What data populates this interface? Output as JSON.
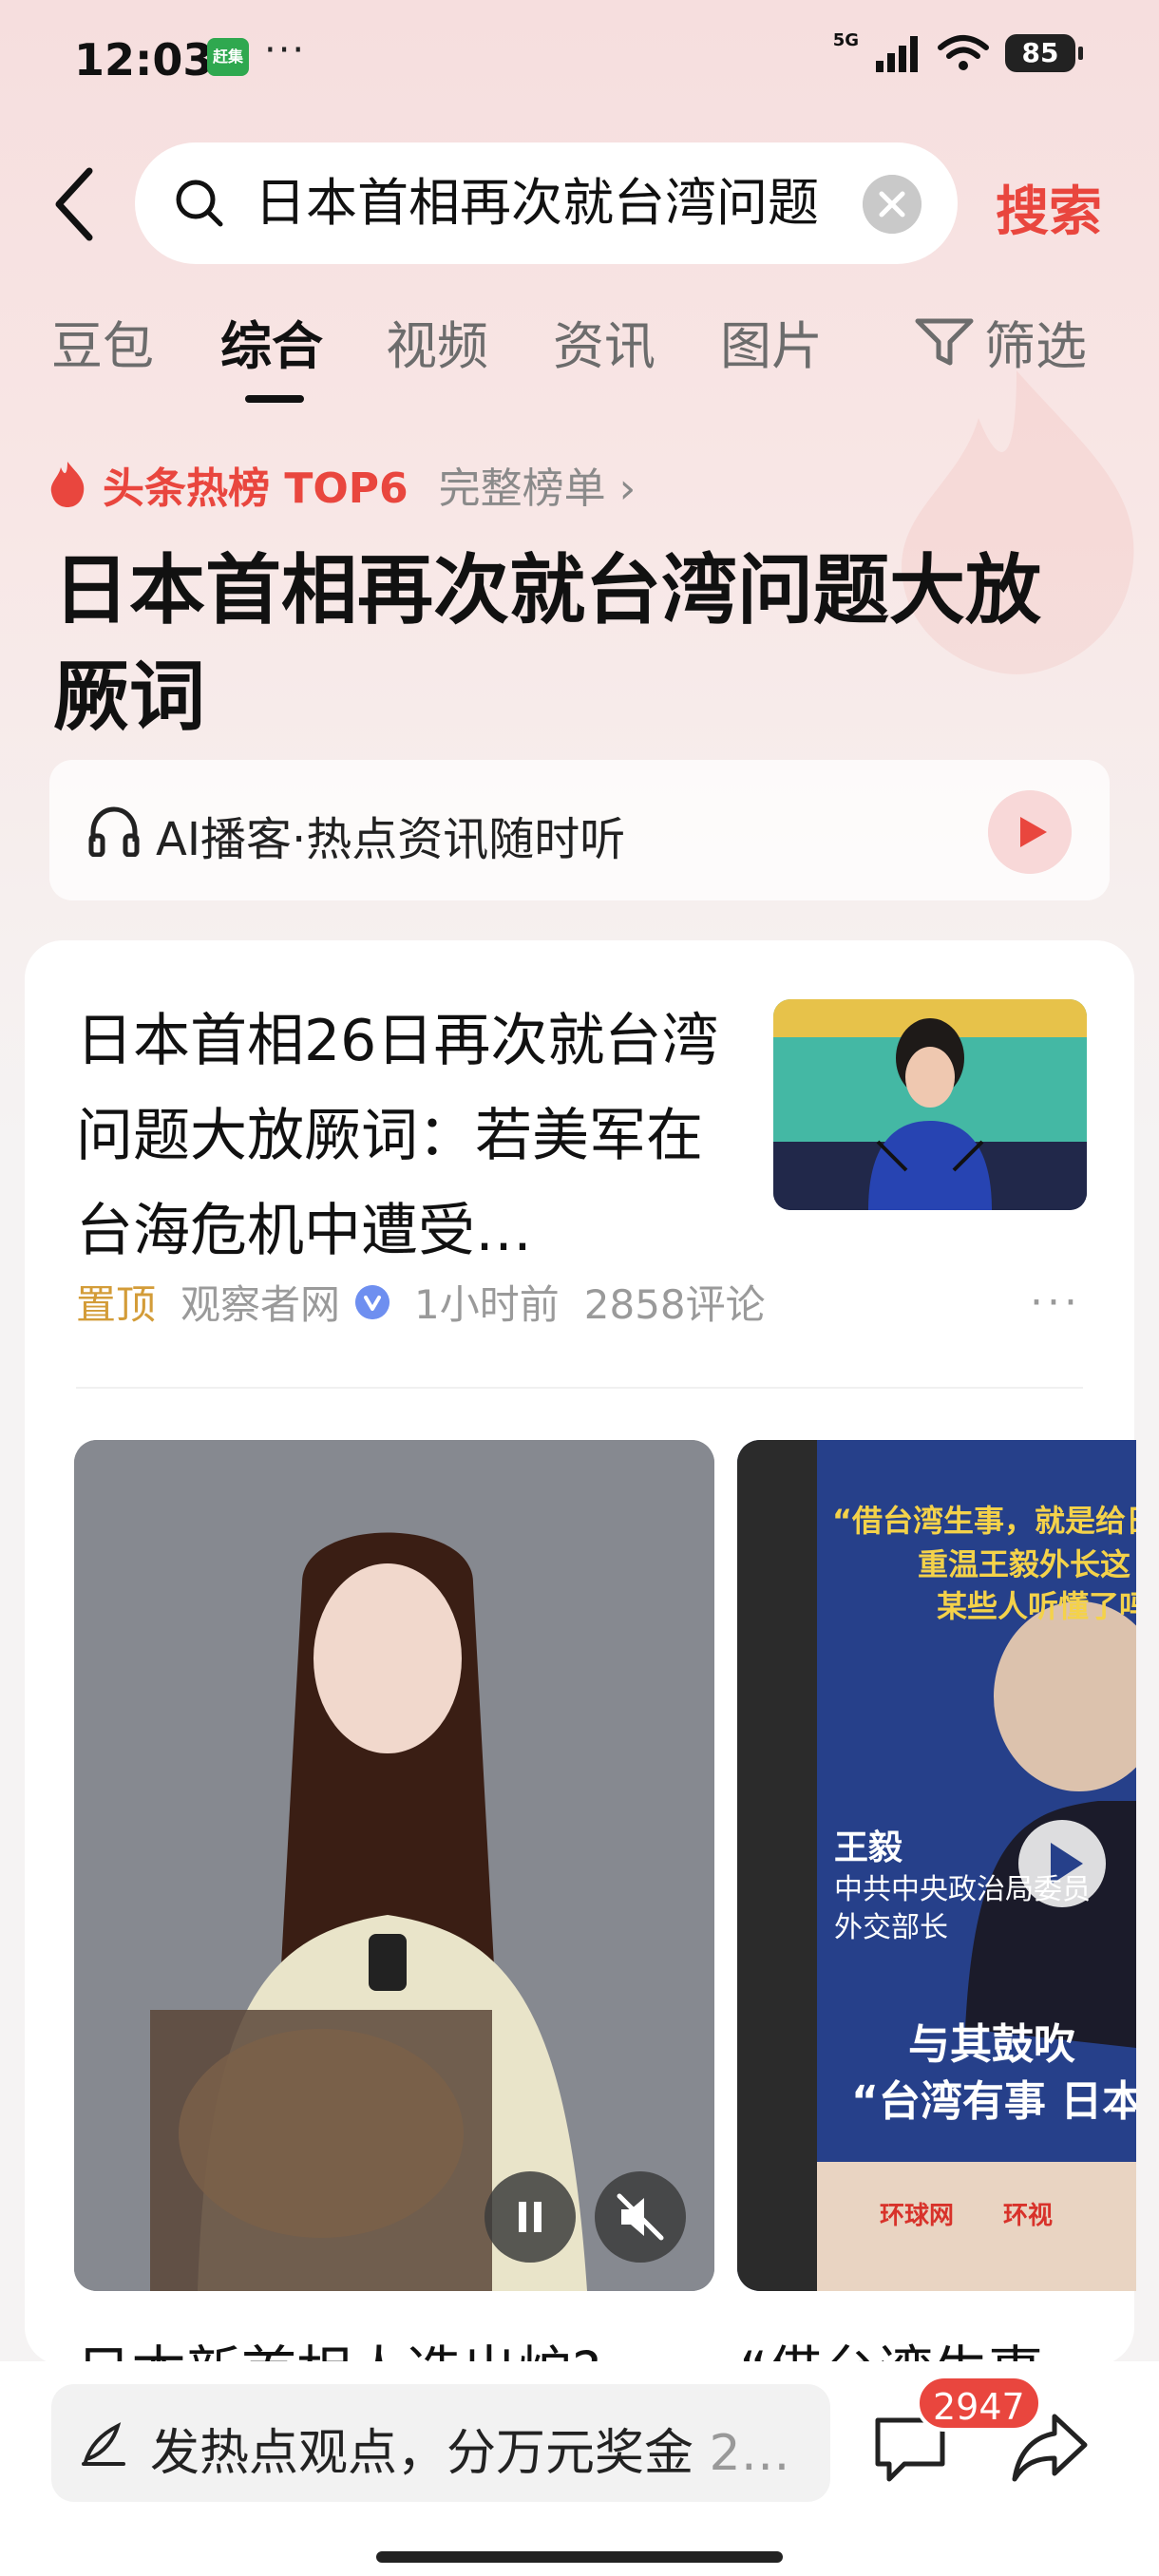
{
  "status_bar": {
    "time": "12:03",
    "app_notification": "赶集",
    "network": "5G",
    "battery": "85"
  },
  "search": {
    "query": "日本首相再次就台湾问题",
    "submit_label": "搜索"
  },
  "tabs": [
    {
      "label": "豆包"
    },
    {
      "label": "综合"
    },
    {
      "label": "视频"
    },
    {
      "label": "资讯"
    },
    {
      "label": "图片"
    }
  ],
  "filter_label": "筛选",
  "hot": {
    "label": "头条热榜 TOP6",
    "full_list": "完整榜单 ›",
    "title": "日本首相再次就台湾问题大放厥词"
  },
  "podcast": {
    "label": "AI播客·热点资讯随时听"
  },
  "article": {
    "title": "日本首相26日再次就台湾问题大放厥词：若美军在台海危机中遭受…",
    "pinned": "置顶",
    "source": "观察者网",
    "time": "1小时前",
    "comments": "2858评论"
  },
  "videos": [
    {
      "title_fragment": "日本新首相人选出炉?"
    },
    {
      "title_fragment": "“借台湾生事",
      "overlay_quote": "“借台湾生事，就是给日",
      "overlay_line2": "重温王毅外长这",
      "overlay_line3": "某些人听懂了吗",
      "speaker_name": "王毅",
      "speaker_role1": "中共中央政治局委员",
      "speaker_role2": "外交部长",
      "caption1": "与其鼓吹",
      "caption2": "“台湾有事 日本",
      "logo1": "环球网",
      "logo2": "环视"
    }
  ],
  "bottom_bar": {
    "comment_placeholder": "发热点观点，分万元奖金",
    "comment_placeholder_ext": " 2…",
    "comment_count": "2947"
  },
  "colors": {
    "accent": "#e9463e",
    "pinned": "#d39c38",
    "verified": "#6e8ff0"
  }
}
